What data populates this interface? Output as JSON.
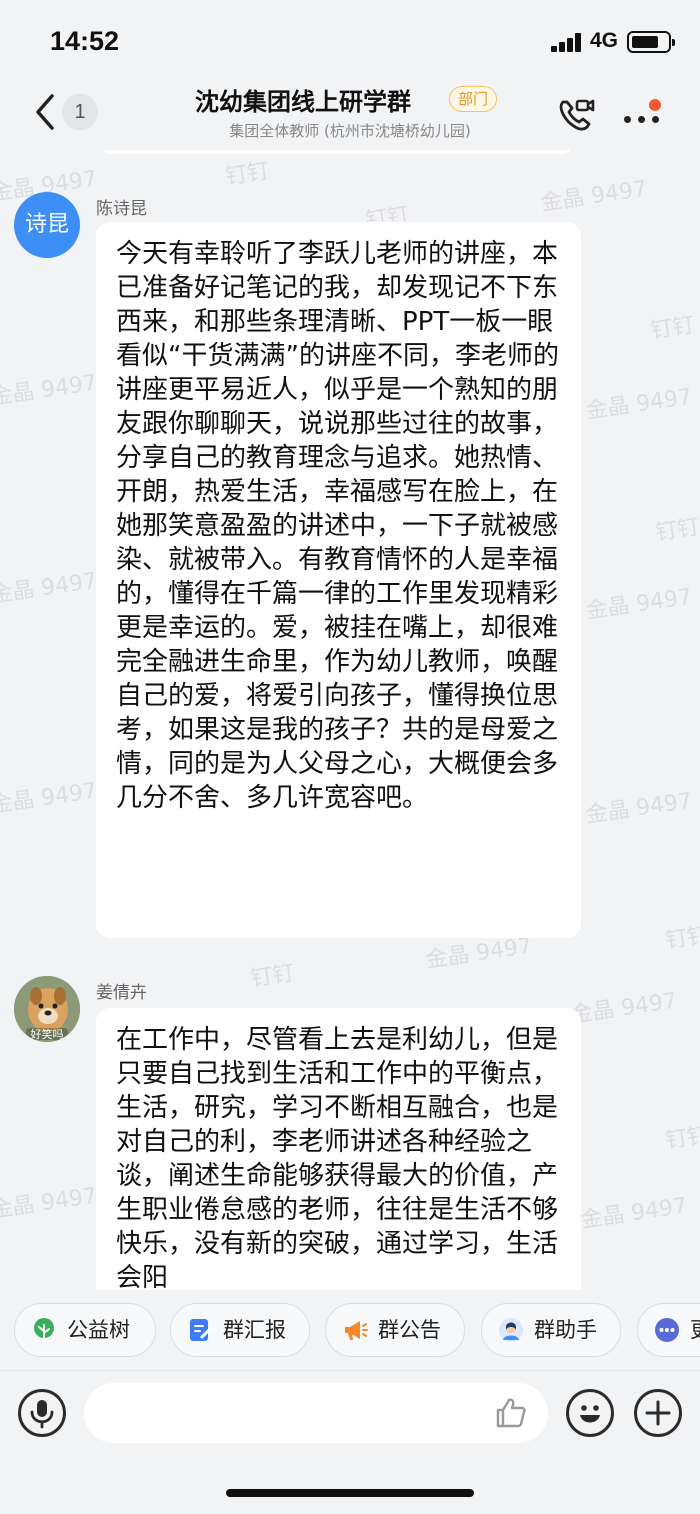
{
  "status_bar": {
    "time": "14:52",
    "network": "4G"
  },
  "header": {
    "back_icon": "chevron-left-icon",
    "unread_count": "1",
    "title": "沈幼集团线上研学群",
    "badge": "部门",
    "subtitle": "集团全体教师 (杭州市沈塘桥幼儿园)",
    "call_icon": "video-call-icon",
    "more_icon": "more-dots-icon"
  },
  "watermarks": [
    "金晶 9497",
    "钉钉"
  ],
  "messages": [
    {
      "sender": "陈诗昆",
      "avatar_text": "诗昆",
      "text": "今天有幸聆听了李跃儿老师的讲座，本已准备好记笔记的我，却发现记不下东西来，和那些条理清晰、PPT一板一眼看似“干货满满”的讲座不同，李老师的讲座更平易近人，似乎是一个熟知的朋友跟你聊聊天，说说那些过往的故事，分享自己的教育理念与追求。她热情、开朗，热爱生活，幸福感写在脸上，在她那笑意盈盈的讲述中，一下子就被感染、就被带入。有教育情怀的人是幸福的，懂得在千篇一律的工作里发现精彩更是幸运的。爱，被挂在嘴上，却很难完全融进生命里，作为幼儿教师，唤醒自己的爱，将爱引向孩子，懂得换位思考，如果这是我的孩子？共的是母爱之情，同的是为人父母之心，大概便会多几分不舍、多几许宽容吧。"
    },
    {
      "sender": "姜倩卉",
      "avatar_caption": "好笑吗",
      "text": "在工作中，尽管看上去是利幼儿，但是只要自己找到生活和工作中的平衡点，生活，研究，学习不断相互融合，也是对自己的利，李老师讲述各种经验之谈，阐述生命能够获得最大的价值，产生职业倦怠感的老师，往往是生活不够快乐，没有新的突破，通过学习，生活会阳"
    }
  ],
  "quick_actions": [
    {
      "label": "公益树",
      "icon": "tree-icon",
      "color": "#3ab05c"
    },
    {
      "label": "群汇报",
      "icon": "report-icon",
      "color": "#3d7cf5"
    },
    {
      "label": "群公告",
      "icon": "megaphone-icon",
      "color": "#f5862b"
    },
    {
      "label": "群助手",
      "icon": "assistant-icon",
      "color": "#3d8ff5"
    },
    {
      "label": "更",
      "icon": "more-icon",
      "color": "#5b6bd6"
    }
  ],
  "input": {
    "placeholder": "",
    "voice_icon": "microphone-icon",
    "like_icon": "thumbs-up-icon",
    "emoji_icon": "emoji-icon",
    "add_icon": "plus-icon"
  }
}
